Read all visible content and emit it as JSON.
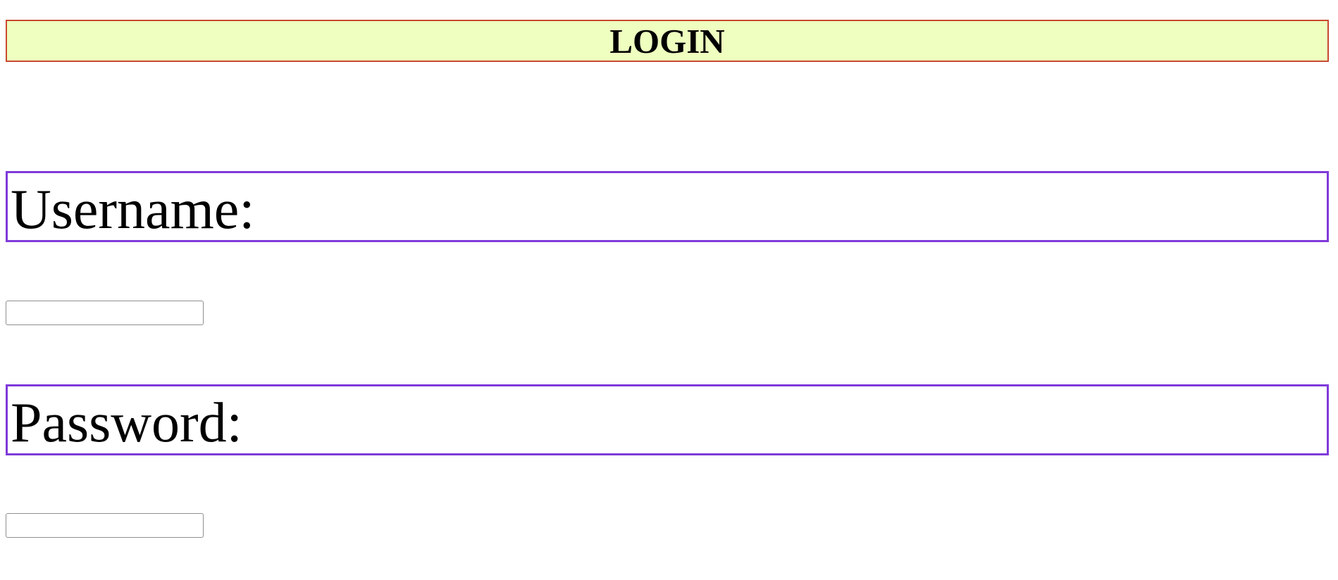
{
  "header": {
    "title": "LOGIN"
  },
  "form": {
    "username": {
      "label": "Username:",
      "value": "",
      "placeholder": ""
    },
    "password": {
      "label": "Password:",
      "value": "",
      "placeholder": ""
    }
  },
  "colors": {
    "header_background": "#eeffbf",
    "header_border": "#c8492f",
    "label_border": "#7f3ad9"
  }
}
